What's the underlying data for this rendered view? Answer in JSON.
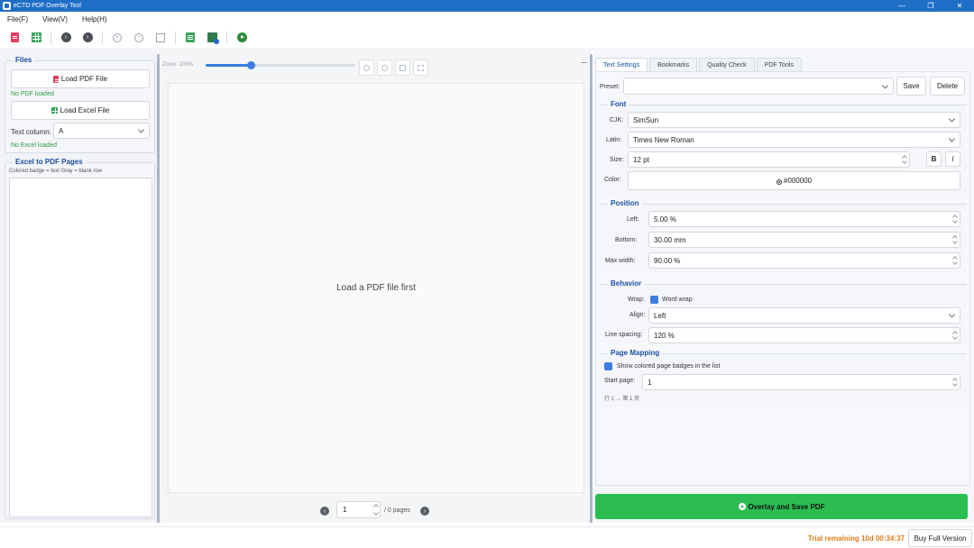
{
  "window": {
    "title": "eCTD PDF Overlay Tool",
    "minimize": "—",
    "maximize": "❐",
    "close": "✕"
  },
  "menu": [
    "File(F)",
    "View(V)",
    "Help(H)"
  ],
  "toolbar": {
    "icons": [
      "pdf-file-icon",
      "excel-file-icon",
      "previous-icon",
      "next-icon",
      "zoom-in-icon",
      "zoom-out-icon",
      "fit-icon",
      "list-icon",
      "check-icon",
      "run-icon"
    ],
    "prev_glyph": "‹",
    "next_glyph": "›",
    "zoom_in_glyph": "+",
    "zoom_out_glyph": "−"
  },
  "files": {
    "title": "Files",
    "load_pdf": "Load PDF File",
    "pdf_status": "No PDF loaded",
    "load_excel": "Load Excel File",
    "text_column_label": "Text column:",
    "text_column_value": "A",
    "excel_status": "No Excel loaded"
  },
  "mapping_list": {
    "title": "Excel to PDF Pages",
    "hint": "Colored badge = text  Gray = blank row"
  },
  "viewer": {
    "zoom_label": "Zoom: 100%",
    "zoom_fraction": 0.3,
    "placeholder": "Load a PDF file first",
    "page_value": "1",
    "page_total": "/ 0 pages"
  },
  "tabs": [
    {
      "label": "Text Settings",
      "active": true
    },
    {
      "label": "Bookmarks",
      "active": false
    },
    {
      "label": "Quality Check",
      "active": false
    },
    {
      "label": "PDF Tools",
      "active": false
    }
  ],
  "preset": {
    "label": "Preset:",
    "value": "",
    "save": "Save",
    "delete": "Delete"
  },
  "font": {
    "title": "Font",
    "cjk_label": "CJK:",
    "cjk_value": "SimSun",
    "latin_label": "Latin:",
    "latin_value": "Times New Roman",
    "size_label": "Size:",
    "size_value": "12 pt",
    "bold": "B",
    "italic": "I",
    "color_label": "Color:",
    "color_value": "#000000"
  },
  "position": {
    "title": "Position",
    "left_label": "Left:",
    "left_value": "5.00 %",
    "bottom_label": "Bottom:",
    "bottom_value": "30.00 mm",
    "maxwidth_label": "Max width:",
    "maxwidth_value": "90.00 %"
  },
  "behavior": {
    "title": "Behavior",
    "wrap_label": "Wrap:",
    "wrap_text": "Word wrap",
    "align_label": "Align:",
    "align_value": "Left",
    "spacing_label": "Line spacing:",
    "spacing_value": "120 %"
  },
  "page_mapping": {
    "title": "Page Mapping",
    "badges_text": "Show colored page badges in the list",
    "start_label": "Start page:",
    "start_value": "1",
    "hint": "行 1 → 第 1 页"
  },
  "action": {
    "overlay": "Overlay and Save PDF"
  },
  "status": {
    "trial": "Trial remaining 10d 00:34:37",
    "buy": "Buy Full Version"
  },
  "colors": {
    "accent": "#1f6fc7",
    "primary_action": "#2bbd52",
    "warning": "#e07b1a",
    "success_text": "#2f9a44",
    "section_title": "#1b4fa3"
  }
}
